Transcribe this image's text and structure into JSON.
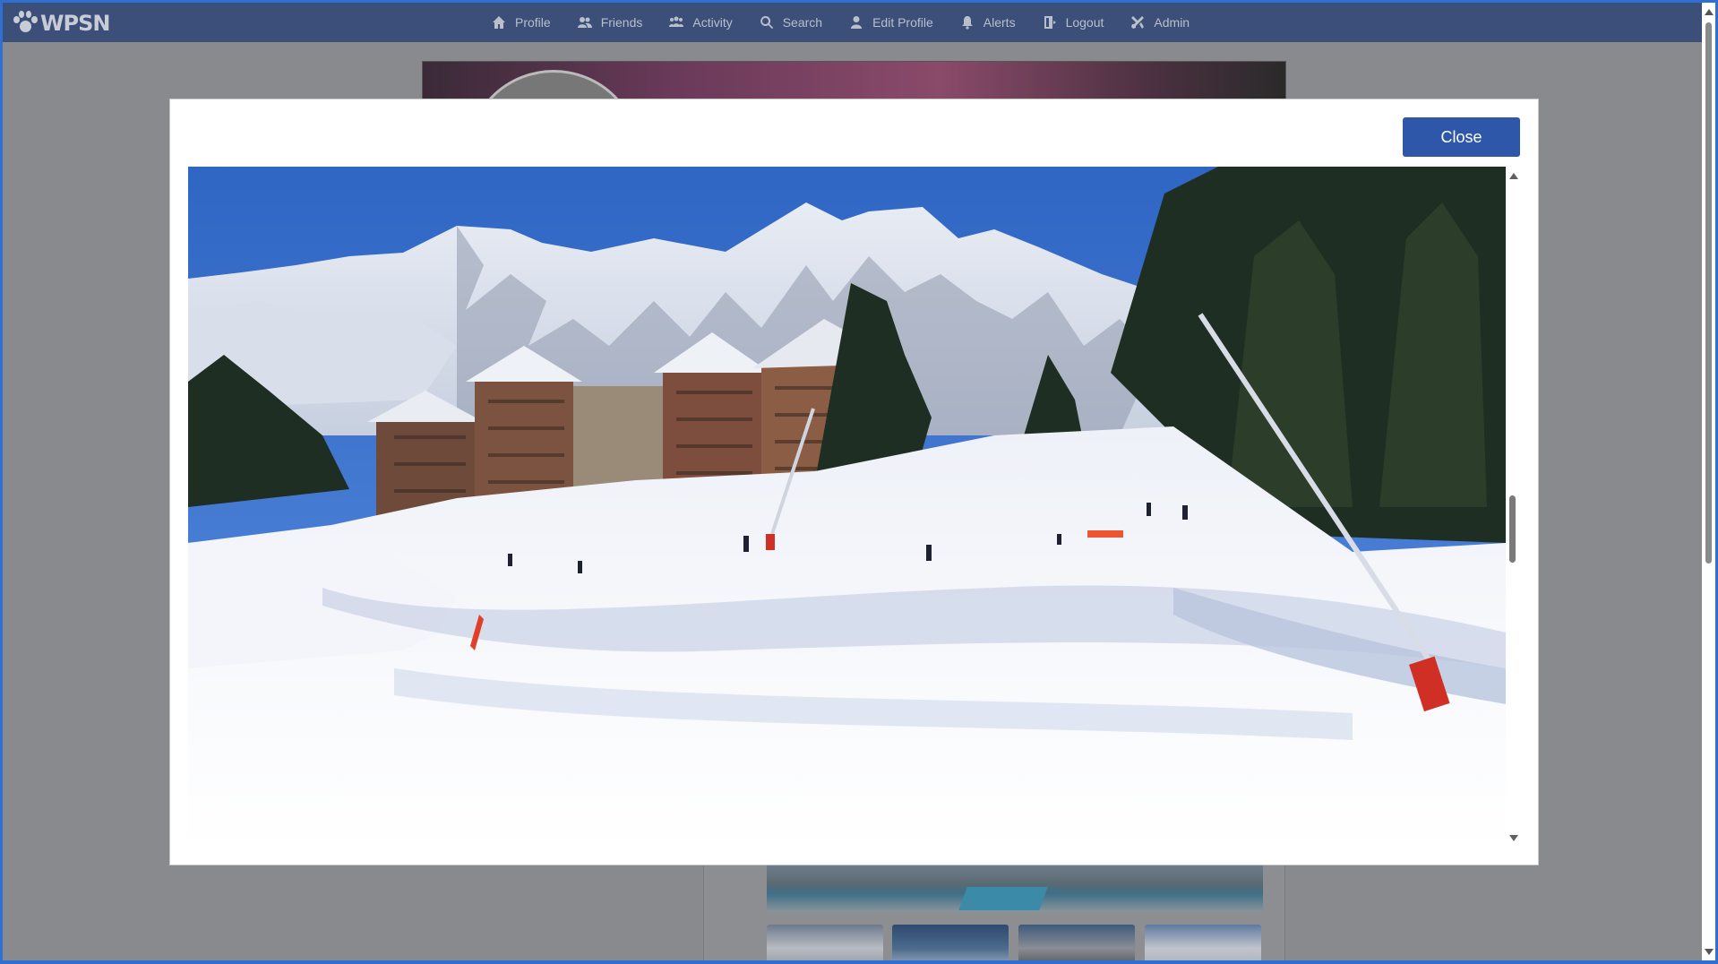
{
  "brand": {
    "name": "WPSN"
  },
  "nav": {
    "items": [
      {
        "label": "Profile",
        "icon": "home-icon"
      },
      {
        "label": "Friends",
        "icon": "friends-icon"
      },
      {
        "label": "Activity",
        "icon": "activity-icon"
      },
      {
        "label": "Search",
        "icon": "search-icon"
      },
      {
        "label": "Edit Profile",
        "icon": "user-icon"
      },
      {
        "label": "Alerts",
        "icon": "bell-icon"
      },
      {
        "label": "Logout",
        "icon": "logout-icon"
      },
      {
        "label": "Admin",
        "icon": "admin-icon"
      }
    ]
  },
  "modal": {
    "close_label": "Close",
    "image_subject": "snowy mountain ski slope with chalet buildings and skiers"
  },
  "colors": {
    "navbar": "#3b4f78",
    "close_button": "#2e57aa",
    "overlay": "#888a8d",
    "frame": "#2e6fd1"
  }
}
